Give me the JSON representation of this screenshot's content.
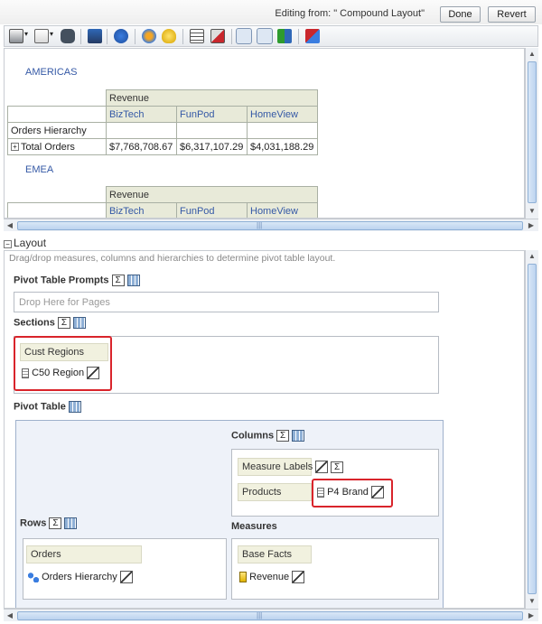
{
  "topbar": {
    "editing_text": "Editing from: \" Compound Layout\"",
    "done_label": "Done",
    "revert_label": "Revert"
  },
  "toolbar": {
    "icons": [
      "print-icon",
      "export-icon",
      "binoculars-icon",
      "filter-icon",
      "refresh-icon",
      "group-icon",
      "lightbulb-icon",
      "table-icon",
      "exclude-icon",
      "pivot-view-icon",
      "layout-icon",
      "sort-icon",
      "properties-icon"
    ]
  },
  "preview": {
    "region1": "AMERICAS",
    "region2": "EMEA",
    "table1": {
      "measure": "Revenue",
      "brands": [
        "BizTech",
        "FunPod",
        "HomeView"
      ],
      "row_header": "Orders Hierarchy",
      "row_label": "Total Orders",
      "values": [
        "$7,768,708.67",
        "$6,317,107.29",
        "$4,031,188.29"
      ]
    },
    "table2": {
      "measure": "Revenue",
      "brands": [
        "BizTech",
        "FunPod",
        "HomeView"
      ]
    }
  },
  "layout": {
    "title": "Layout",
    "hint": "Drag/drop measures, columns and hierarchies to determine pivot table layout.",
    "prompts_label": "Pivot Table Prompts",
    "prompts_drop": "Drop Here for Pages",
    "sections_label": "Sections",
    "sections_chip": "Cust Regions",
    "sections_item": "C50  Region",
    "pivot_label": "Pivot Table",
    "columns_label": "Columns",
    "measure_labels": "Measure Labels",
    "products_chip": "Products",
    "products_item": "P4  Brand",
    "rows_label": "Rows",
    "orders_chip": "Orders",
    "orders_item": "Orders Hierarchy",
    "measures_label": "Measures",
    "basefacts_chip": "Base Facts",
    "revenue_item": "Revenue"
  },
  "colors": {
    "highlight": "#d9242b",
    "link": "#3559a6",
    "pivot_bg": "#eef2f9"
  }
}
